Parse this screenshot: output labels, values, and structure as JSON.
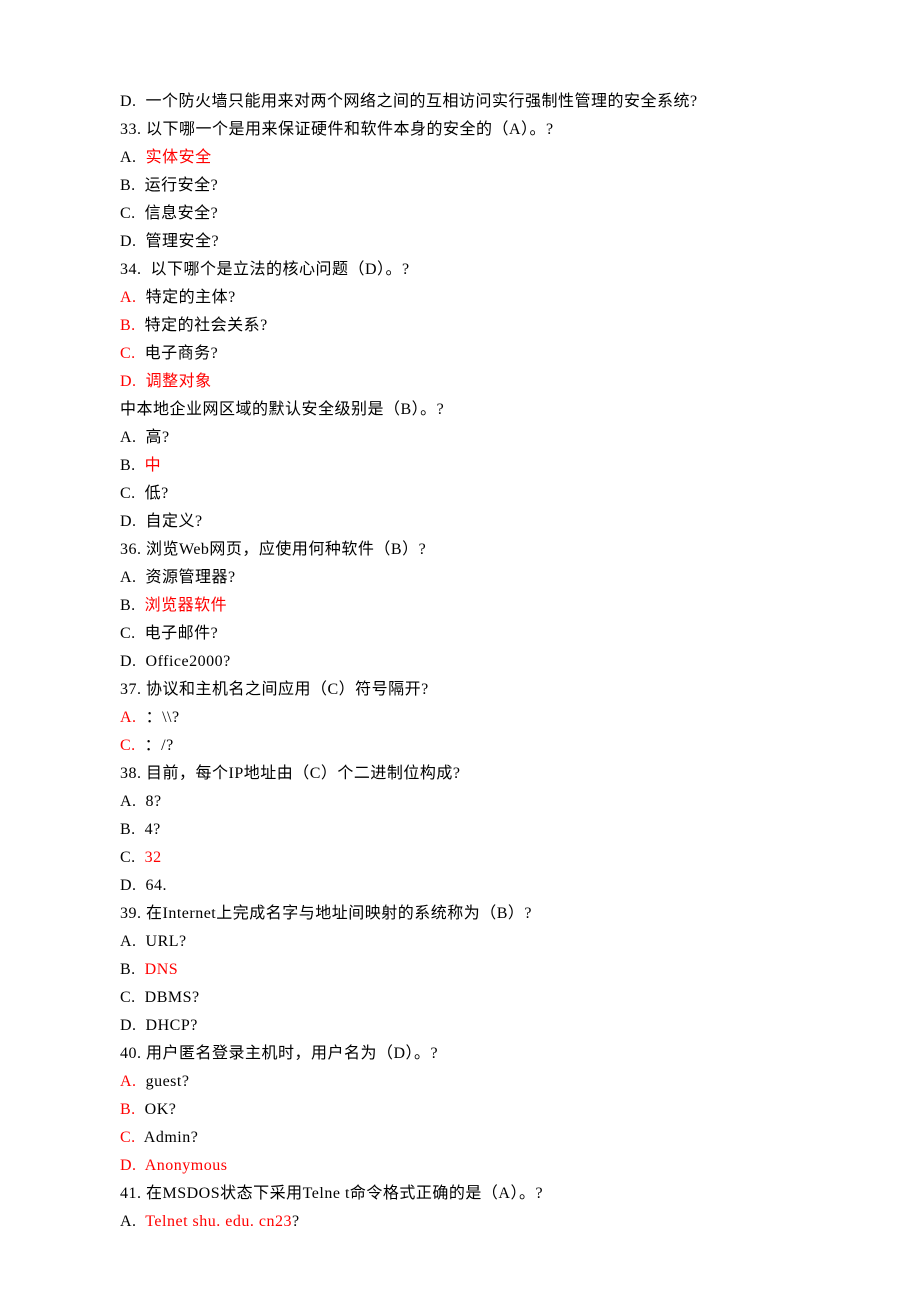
{
  "lines": [
    {
      "parts": [
        {
          "t": "D.  一个防火墙只能用来对两个网络之间的互相访问实行强制性管理的安全系统?",
          "c": "black"
        }
      ]
    },
    {
      "parts": [
        {
          "t": "33. 以下哪一个是用来保证硬件和软件本身的安全的（A）。?",
          "c": "black"
        }
      ]
    },
    {
      "parts": [
        {
          "t": "A.  ",
          "c": "black"
        },
        {
          "t": "实体安全",
          "c": "red"
        }
      ]
    },
    {
      "parts": [
        {
          "t": "B.  运行安全?",
          "c": "black"
        }
      ]
    },
    {
      "parts": [
        {
          "t": "C.  信息安全?",
          "c": "black"
        }
      ]
    },
    {
      "parts": [
        {
          "t": "D.  管理安全?",
          "c": "black"
        }
      ]
    },
    {
      "parts": [
        {
          "t": "34.  以下哪个是立法的核心问题（D）。?",
          "c": "black"
        }
      ]
    },
    {
      "parts": [
        {
          "t": "A.",
          "c": "red"
        },
        {
          "t": "  特定的主体?",
          "c": "black"
        }
      ]
    },
    {
      "parts": [
        {
          "t": "B.",
          "c": "red"
        },
        {
          "t": "  特定的社会关系?",
          "c": "black"
        }
      ]
    },
    {
      "parts": [
        {
          "t": "C.",
          "c": "red"
        },
        {
          "t": "  电子商务?",
          "c": "black"
        }
      ]
    },
    {
      "parts": [
        {
          "t": "D.",
          "c": "red"
        },
        {
          "t": "  ",
          "c": "black"
        },
        {
          "t": "调整对象",
          "c": "red"
        }
      ]
    },
    {
      "parts": [
        {
          "t": "中本地企业网区域的默认安全级别是（B）。?",
          "c": "black"
        }
      ]
    },
    {
      "parts": [
        {
          "t": "A.  高?",
          "c": "black"
        }
      ]
    },
    {
      "parts": [
        {
          "t": "B.  ",
          "c": "black"
        },
        {
          "t": "中",
          "c": "red"
        }
      ]
    },
    {
      "parts": [
        {
          "t": "C.  低?",
          "c": "black"
        }
      ]
    },
    {
      "parts": [
        {
          "t": "D.  自定义?",
          "c": "black"
        }
      ]
    },
    {
      "parts": [
        {
          "t": "36. 浏览Web网页，应使用何种软件（B）?",
          "c": "black"
        }
      ]
    },
    {
      "parts": [
        {
          "t": "A.  资源管理器?",
          "c": "black"
        }
      ]
    },
    {
      "parts": [
        {
          "t": "B.  ",
          "c": "black"
        },
        {
          "t": "浏览器软件",
          "c": "red"
        }
      ]
    },
    {
      "parts": [
        {
          "t": "C.  电子邮件?",
          "c": "black"
        }
      ]
    },
    {
      "parts": [
        {
          "t": "D.  Office2000?",
          "c": "black"
        }
      ]
    },
    {
      "parts": [
        {
          "t": "37. 协议和主机名之间应用（C）符号隔开?",
          "c": "black"
        }
      ]
    },
    {
      "parts": [
        {
          "t": "A.",
          "c": "red"
        },
        {
          "t": "  ：\\\\?",
          "c": "black"
        }
      ]
    },
    {
      "parts": [
        {
          "t": "C.",
          "c": "red"
        },
        {
          "t": "  ：/?",
          "c": "black"
        }
      ]
    },
    {
      "parts": [
        {
          "t": "38. 目前，每个IP地址由（C）个二进制位构成?",
          "c": "black"
        }
      ]
    },
    {
      "parts": [
        {
          "t": "A.  8?",
          "c": "black"
        }
      ]
    },
    {
      "parts": [
        {
          "t": "B.  4?",
          "c": "black"
        }
      ]
    },
    {
      "parts": [
        {
          "t": "C.  ",
          "c": "black"
        },
        {
          "t": "32",
          "c": "red"
        }
      ]
    },
    {
      "parts": [
        {
          "t": "D.  64.",
          "c": "black"
        }
      ]
    },
    {
      "parts": [
        {
          "t": "39. 在Internet上完成名字与地址间映射的系统称为（B）?",
          "c": "black"
        }
      ]
    },
    {
      "parts": [
        {
          "t": "A.  URL?",
          "c": "black"
        }
      ]
    },
    {
      "parts": [
        {
          "t": "B.  ",
          "c": "black"
        },
        {
          "t": "DNS",
          "c": "red"
        }
      ]
    },
    {
      "parts": [
        {
          "t": "C.  DBMS?",
          "c": "black"
        }
      ]
    },
    {
      "parts": [
        {
          "t": "D.  DHCP?",
          "c": "black"
        }
      ]
    },
    {
      "parts": [
        {
          "t": "40. 用户匿名登录主机时，用户名为（D）。?",
          "c": "black"
        }
      ]
    },
    {
      "parts": [
        {
          "t": "A.",
          "c": "red"
        },
        {
          "t": "  guest?",
          "c": "black"
        }
      ]
    },
    {
      "parts": [
        {
          "t": "B.",
          "c": "red"
        },
        {
          "t": "  OK?",
          "c": "black"
        }
      ]
    },
    {
      "parts": [
        {
          "t": "C.",
          "c": "red"
        },
        {
          "t": "  Admin?",
          "c": "black"
        }
      ]
    },
    {
      "parts": [
        {
          "t": "D.",
          "c": "red"
        },
        {
          "t": "  ",
          "c": "black"
        },
        {
          "t": "Anonymous",
          "c": "red"
        }
      ]
    },
    {
      "parts": [
        {
          "t": "41. 在MSDOS状态下采用Telne t命令格式正确的是（A）。?",
          "c": "black"
        }
      ]
    },
    {
      "parts": [
        {
          "t": "A.  ",
          "c": "black"
        },
        {
          "t": "Telnet shu. edu. cn23",
          "c": "red"
        },
        {
          "t": "?",
          "c": "black"
        }
      ]
    }
  ]
}
